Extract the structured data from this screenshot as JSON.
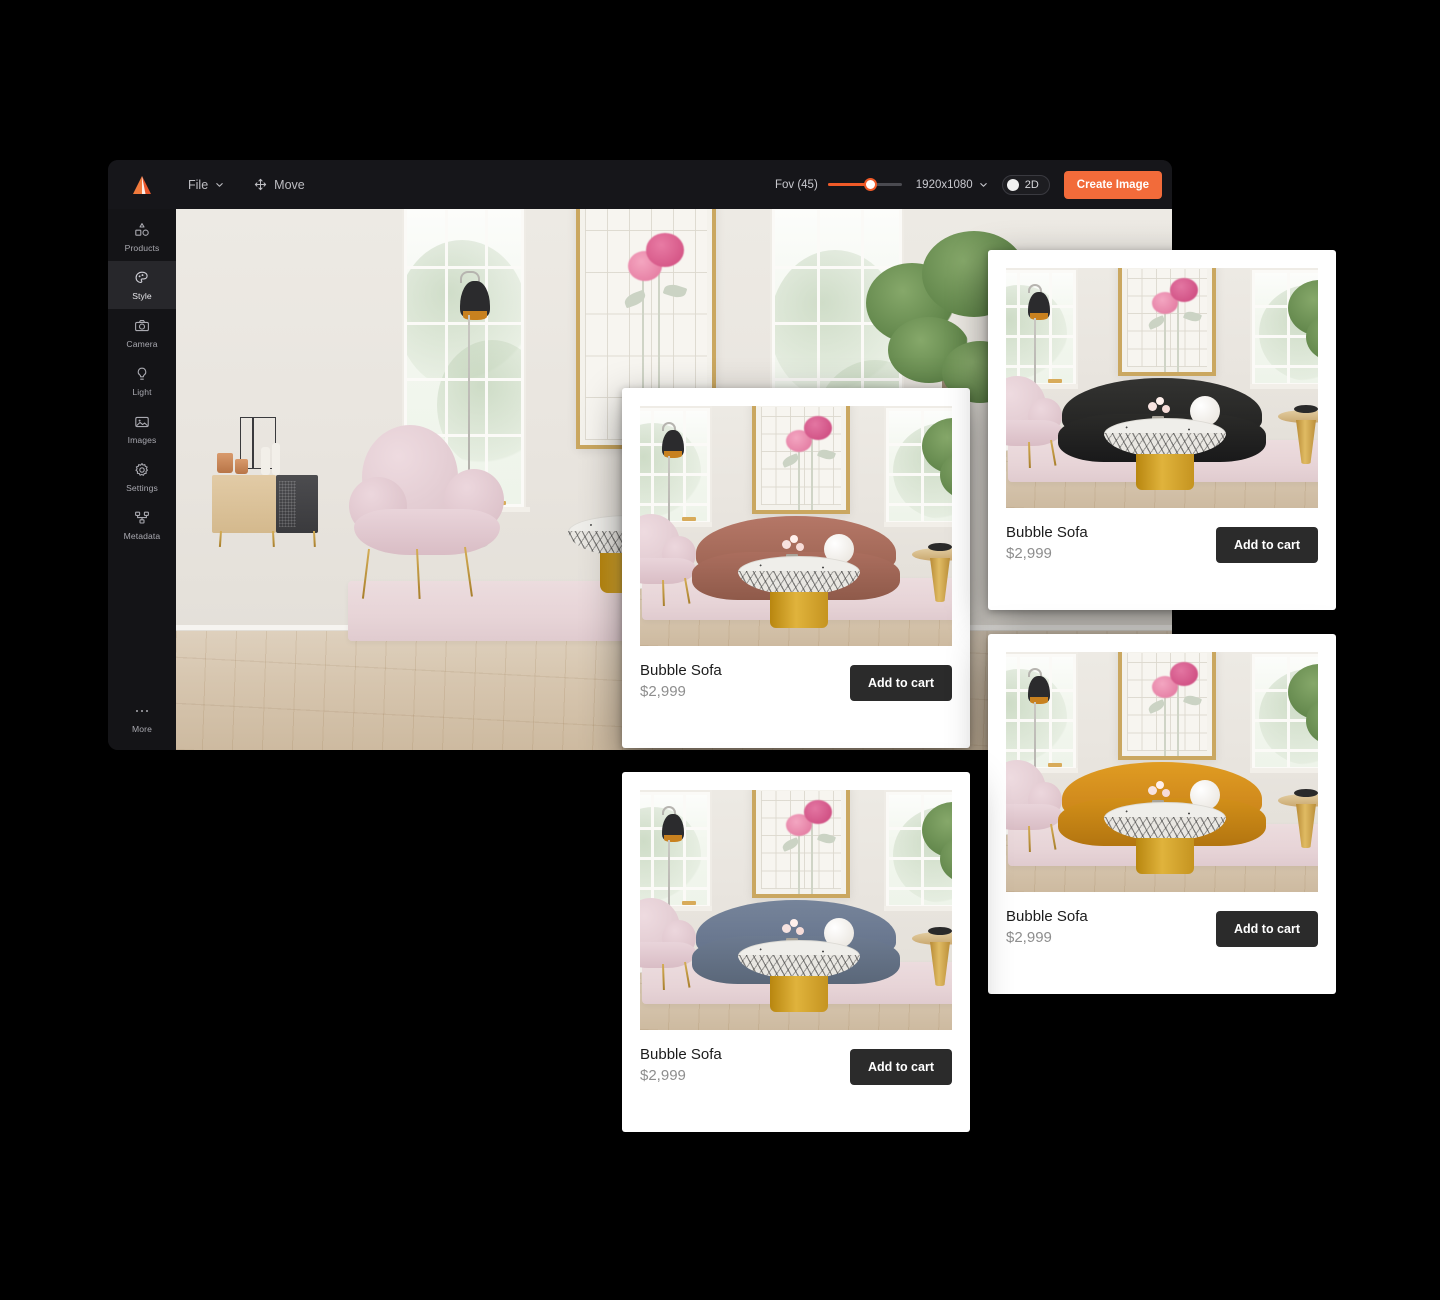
{
  "app": {
    "logo_icon": "mountain-logo-icon",
    "toolbar": {
      "file_label": "File",
      "file_chevron_icon": "chevron-down-icon",
      "move_label": "Move",
      "move_icon": "move-arrows-icon",
      "fov_label": "Fov (45)",
      "fov_value": 45,
      "fov_percent": 57,
      "resolution_label": "1920x1080",
      "resolution_chevron_icon": "chevron-down-icon",
      "toggle_2d_label": "2D",
      "create_button_label": "Create Image",
      "accent_color": "#F26B3A",
      "toolbar_bg": "#16161a"
    },
    "sidebar": {
      "items": [
        {
          "label": "Products",
          "icon": "shapes-icon",
          "active": false
        },
        {
          "label": "Style",
          "icon": "palette-icon",
          "active": true
        },
        {
          "label": "Camera",
          "icon": "camera-icon",
          "active": false
        },
        {
          "label": "Light",
          "icon": "bulb-icon",
          "active": false
        },
        {
          "label": "Images",
          "icon": "image-icon",
          "active": false
        },
        {
          "label": "Settings",
          "icon": "gear-icon",
          "active": false
        },
        {
          "label": "Metadata",
          "icon": "node-graph-icon",
          "active": false
        }
      ],
      "more": {
        "label": "More",
        "icon": "ellipsis-icon"
      }
    },
    "viewport": {
      "scene_name": "living-room-3d-scene",
      "sofa_color": "#9e0f22",
      "armchair_color": "#e3c7cf"
    }
  },
  "cards": [
    {
      "id": "card-terracotta",
      "title": "Bubble Sofa",
      "price": "$2,999",
      "cart_label": "Add to cart",
      "sofa_color": "#b57767",
      "sofa_color_dark": "#9c6352"
    },
    {
      "id": "card-black",
      "title": "Bubble Sofa",
      "price": "$2,999",
      "cart_label": "Add to cart",
      "sofa_color": "#2e2e2c",
      "sofa_color_dark": "#1d1d1c"
    },
    {
      "id": "card-amber",
      "title": "Bubble Sofa",
      "price": "$2,999",
      "cart_label": "Add to cart",
      "sofa_color": "#d8941d",
      "sofa_color_dark": "#bb7c11"
    },
    {
      "id": "card-slate",
      "title": "Bubble Sofa",
      "price": "$2,999",
      "cart_label": "Add to cart",
      "sofa_color": "#6e7c90",
      "sofa_color_dark": "#5a6778"
    }
  ]
}
